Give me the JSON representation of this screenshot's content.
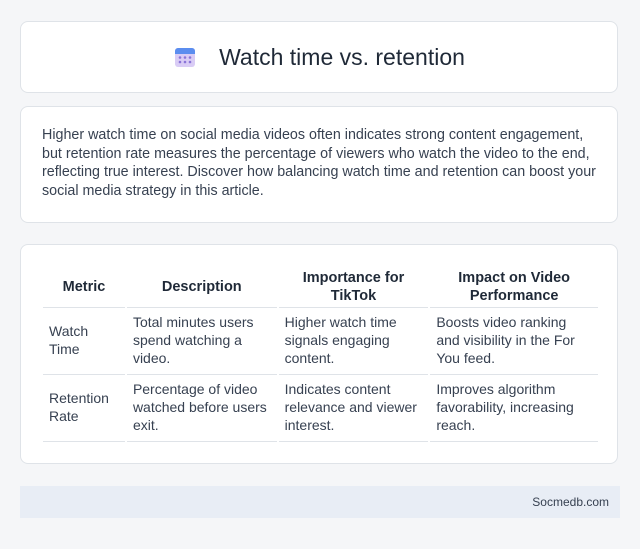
{
  "header": {
    "icon": "calendar-icon",
    "title": "Watch time vs. retention"
  },
  "intro": {
    "text": "Higher watch time on social media videos often indicates strong content engagement, but retention rate measures the percentage of viewers who watch the video to the end, reflecting true interest. Discover how balancing watch time and retention can boost your social media strategy in this article."
  },
  "table": {
    "headers": [
      "Metric",
      "Description",
      "Importance for TikTok",
      "Impact on Video Performance"
    ],
    "rows": [
      [
        "Watch Time",
        "Total minutes users spend watching a video.",
        "Higher watch time signals engaging content.",
        "Boosts video ranking and visibility in the For You feed."
      ],
      [
        "Retention Rate",
        "Percentage of video watched before users exit.",
        "Indicates content relevance and viewer interest.",
        "Improves algorithm favorability, increasing reach."
      ]
    ]
  },
  "footer": {
    "text": "Socmedb.com"
  },
  "colors": {
    "page_bg": "#f5f6f8",
    "card_border": "#dfe3e8",
    "footer_bg": "#e8edf5",
    "icon_header": "#5b8def",
    "icon_body": "#c9b8f0"
  }
}
